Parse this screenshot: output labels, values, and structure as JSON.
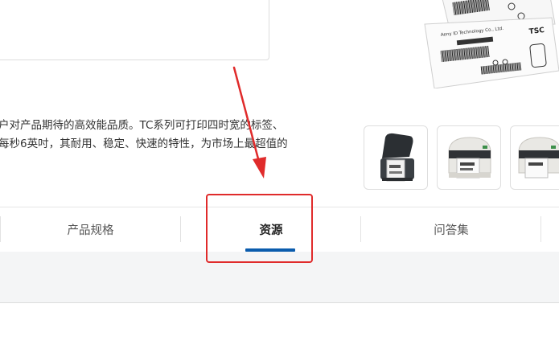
{
  "description": {
    "line1": "户对产品期待的高效能品质。TC系列可打印四时宽的标签、",
    "line2": "每秒6英吋，其耐用、稳定、快速的特性，为市场上最超值的"
  },
  "hero_label": {
    "brand_left": "Aeny ID Technology Co., Ltd.",
    "brand_right": "TSC"
  },
  "tabs": [
    {
      "label": "产品规格",
      "active": false
    },
    {
      "label": "资源",
      "active": true
    },
    {
      "label": "问答集",
      "active": false
    }
  ],
  "colors": {
    "accent": "#0b5cad",
    "annotation": "#e02b2b"
  }
}
